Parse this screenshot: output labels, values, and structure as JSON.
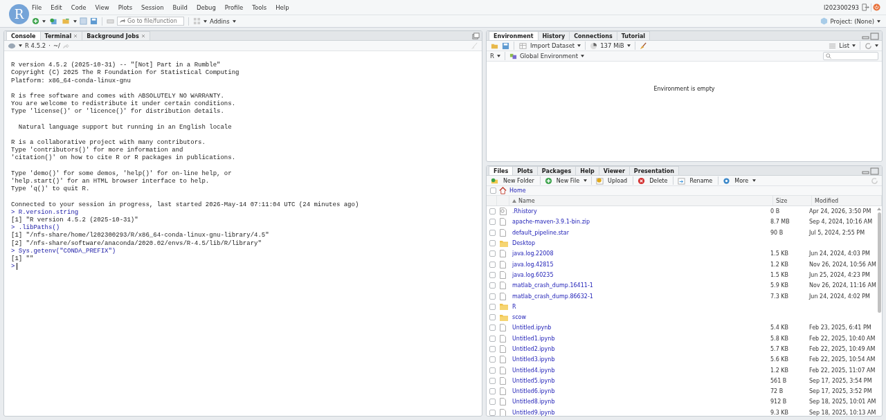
{
  "app": {
    "logo": "R",
    "menu": [
      "File",
      "Edit",
      "Code",
      "View",
      "Plots",
      "Session",
      "Build",
      "Debug",
      "Profile",
      "Tools",
      "Help"
    ],
    "goto_placeholder": "Go to file/function",
    "addins": "Addins",
    "user": "l202300293",
    "project": "Project: (None)"
  },
  "console": {
    "tabs": [
      {
        "label": "Console",
        "selected": true,
        "closable": false
      },
      {
        "label": "Terminal",
        "selected": false,
        "closable": true
      },
      {
        "label": "Background Jobs",
        "selected": false,
        "closable": true
      }
    ],
    "version": "R 4.5.2",
    "separator": "·",
    "path": "~/",
    "lines": [
      {
        "kind": "blank"
      },
      {
        "kind": "output",
        "text": "R version 4.5.2 (2025-10-31) -- \"[Not] Part in a Rumble\""
      },
      {
        "kind": "output",
        "text": "Copyright (C) 2025 The R Foundation for Statistical Computing"
      },
      {
        "kind": "output",
        "text": "Platform: x86_64-conda-linux-gnu"
      },
      {
        "kind": "blank"
      },
      {
        "kind": "output",
        "text": "R is free software and comes with ABSOLUTELY NO WARRANTY."
      },
      {
        "kind": "output",
        "text": "You are welcome to redistribute it under certain conditions."
      },
      {
        "kind": "output",
        "text": "Type 'license()' or 'licence()' for distribution details."
      },
      {
        "kind": "blank"
      },
      {
        "kind": "output",
        "text": "  Natural language support but running in an English locale"
      },
      {
        "kind": "blank"
      },
      {
        "kind": "output",
        "text": "R is a collaborative project with many contributors."
      },
      {
        "kind": "output",
        "text": "Type 'contributors()' for more information and"
      },
      {
        "kind": "output",
        "text": "'citation()' on how to cite R or R packages in publications."
      },
      {
        "kind": "blank"
      },
      {
        "kind": "output",
        "text": "Type 'demo()' for some demos, 'help()' for on-line help, or"
      },
      {
        "kind": "output",
        "text": "'help.start()' for an HTML browser interface to help."
      },
      {
        "kind": "output",
        "text": "Type 'q()' to quit R."
      },
      {
        "kind": "blank"
      },
      {
        "kind": "output",
        "text": "Connected to your session in progress, last started 2026-May-14 07:11:04 UTC (24 minutes ago)"
      },
      {
        "kind": "input",
        "prompt": ">",
        "text": "R.version.string"
      },
      {
        "kind": "output",
        "text": "[1] \"R version 4.5.2 (2025-10-31)\""
      },
      {
        "kind": "input",
        "prompt": ">",
        "text": ".libPaths()"
      },
      {
        "kind": "output",
        "text": "[1] \"/nfs-share/home/l202300293/R/x86_64-conda-linux-gnu-library/4.5\""
      },
      {
        "kind": "output",
        "text": "[2] \"/nfs-share/software/anaconda/2020.02/envs/R-4.5/lib/R/library\""
      },
      {
        "kind": "input",
        "prompt": ">",
        "text": "Sys.getenv(\"CONDA_PREFIX\")"
      },
      {
        "kind": "output",
        "text": "[1] \"\""
      },
      {
        "kind": "cursor",
        "prompt": ">"
      }
    ]
  },
  "environment": {
    "tabs": [
      {
        "label": "Environment",
        "selected": true
      },
      {
        "label": "History",
        "selected": false
      },
      {
        "label": "Connections",
        "selected": false
      },
      {
        "label": "Tutorial",
        "selected": false
      }
    ],
    "import": "Import Dataset",
    "memory": "137 MiB",
    "view": "List",
    "language": "R",
    "scope": "Global Environment",
    "empty": "Environment is empty"
  },
  "files": {
    "tabs": [
      {
        "label": "Files",
        "selected": true
      },
      {
        "label": "Plots",
        "selected": false
      },
      {
        "label": "Packages",
        "selected": false
      },
      {
        "label": "Help",
        "selected": false
      },
      {
        "label": "Viewer",
        "selected": false
      },
      {
        "label": "Presentation",
        "selected": false
      }
    ],
    "actions": [
      {
        "kind": "new-folder",
        "label": "New Folder",
        "menu": false
      },
      {
        "kind": "new-file",
        "label": "New File",
        "menu": true
      },
      {
        "kind": "upload",
        "label": "Upload",
        "menu": false
      },
      {
        "kind": "delete",
        "label": "Delete",
        "menu": false
      },
      {
        "kind": "rename",
        "label": "Rename",
        "menu": false
      },
      {
        "kind": "more",
        "label": "More",
        "menu": true
      }
    ],
    "breadcrumb": "Home",
    "all_checked": false,
    "columns": [
      "Name",
      "Size",
      "Modified"
    ],
    "rows": [
      {
        "kind": "history",
        "name": ".Rhistory",
        "size": "0 B",
        "modified": "Apr 24, 2026, 3:50 PM",
        "checked": false
      },
      {
        "kind": "file",
        "name": "apache-maven-3.9.1-bin.zip",
        "size": "8.7 MB",
        "modified": "Sep 4, 2024, 10:16 AM",
        "checked": false
      },
      {
        "kind": "file",
        "name": "default_pipeline.star",
        "size": "90 B",
        "modified": "Jul 5, 2024, 2:55 PM",
        "checked": false
      },
      {
        "kind": "folder",
        "name": "Desktop",
        "checked": false
      },
      {
        "kind": "file",
        "name": "java.log.22008",
        "size": "1.5 KB",
        "modified": "Jun 24, 2024, 4:03 PM",
        "checked": false
      },
      {
        "kind": "file",
        "name": "java.log.42815",
        "size": "1.2 KB",
        "modified": "Nov 26, 2024, 10:56 AM",
        "checked": false
      },
      {
        "kind": "file",
        "name": "java.log.60235",
        "size": "1.5 KB",
        "modified": "Jun 25, 2024, 4:23 PM",
        "checked": false
      },
      {
        "kind": "file",
        "name": "matlab_crash_dump.16411-1",
        "size": "5.9 KB",
        "modified": "Nov 26, 2024, 11:16 AM",
        "checked": false
      },
      {
        "kind": "file",
        "name": "matlab_crash_dump.86632-1",
        "size": "7.3 KB",
        "modified": "Jun 24, 2024, 4:02 PM",
        "checked": false
      },
      {
        "kind": "folder",
        "name": "R",
        "checked": false
      },
      {
        "kind": "folder",
        "name": "scow",
        "checked": false
      },
      {
        "kind": "file",
        "name": "Untitled.ipynb",
        "size": "5.4 KB",
        "modified": "Feb 23, 2025, 6:41 PM",
        "checked": false
      },
      {
        "kind": "file",
        "name": "Untitled1.ipynb",
        "size": "5.8 KB",
        "modified": "Feb 22, 2025, 10:40 AM",
        "checked": false
      },
      {
        "kind": "file",
        "name": "Untitled2.ipynb",
        "size": "5.7 KB",
        "modified": "Feb 22, 2025, 10:49 AM",
        "checked": false
      },
      {
        "kind": "file",
        "name": "Untitled3.ipynb",
        "size": "5.6 KB",
        "modified": "Feb 22, 2025, 10:54 AM",
        "checked": false
      },
      {
        "kind": "file",
        "name": "Untitled4.ipynb",
        "size": "1.2 KB",
        "modified": "Feb 22, 2025, 11:07 AM",
        "checked": false
      },
      {
        "kind": "file",
        "name": "Untitled5.ipynb",
        "size": "561 B",
        "modified": "Sep 17, 2025, 3:54 PM",
        "checked": false
      },
      {
        "kind": "file",
        "name": "Untitled6.ipynb",
        "size": "72 B",
        "modified": "Sep 17, 2025, 3:52 PM",
        "checked": false
      },
      {
        "kind": "file",
        "name": "Untitled8.ipynb",
        "size": "912 B",
        "modified": "Sep 18, 2025, 10:01 AM",
        "checked": false
      },
      {
        "kind": "file",
        "name": "Untitled9.ipynb",
        "size": "9.3 KB",
        "modified": "Sep 18, 2025, 10:13 AM",
        "checked": false
      }
    ]
  }
}
